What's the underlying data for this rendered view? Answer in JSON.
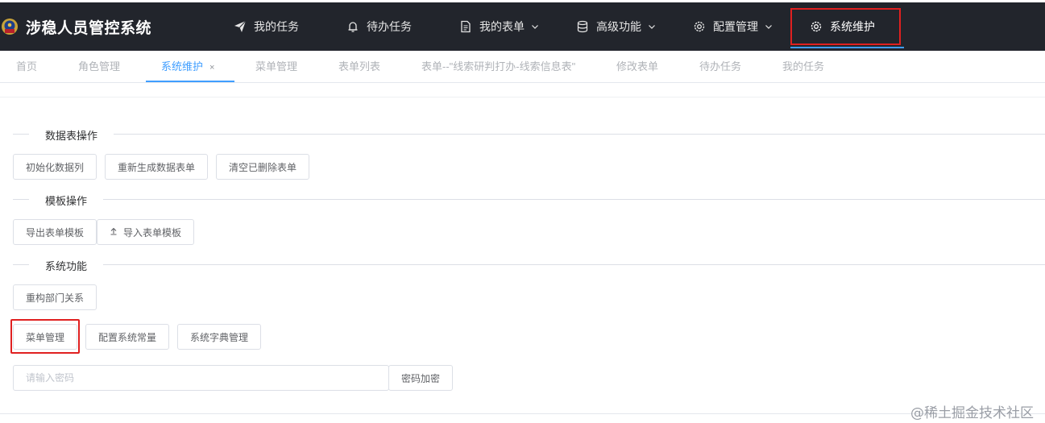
{
  "app": {
    "title": "涉稳人员管控系统",
    "accent_color": "#409eff",
    "header_bg": "#22252c",
    "highlight_color": "#e02020"
  },
  "nav": [
    {
      "label": "我的任务",
      "icon": "send-icon",
      "has_dropdown": false
    },
    {
      "label": "待办任务",
      "icon": "bell-icon",
      "has_dropdown": false
    },
    {
      "label": "我的表单",
      "icon": "document-icon",
      "has_dropdown": true
    },
    {
      "label": "高级功能",
      "icon": "database-icon",
      "has_dropdown": true
    },
    {
      "label": "配置管理",
      "icon": "gear-icon",
      "has_dropdown": true
    },
    {
      "label": "系统维护",
      "icon": "gear-icon",
      "has_dropdown": false,
      "active": true
    }
  ],
  "tabs": [
    {
      "label": "首页"
    },
    {
      "label": "角色管理"
    },
    {
      "label": "系统维护",
      "active": true,
      "close": "×"
    },
    {
      "label": "菜单管理"
    },
    {
      "label": "表单列表"
    },
    {
      "label": "表单--\"线索研判打办-线索信息表\""
    },
    {
      "label": "修改表单"
    },
    {
      "label": "待办任务"
    },
    {
      "label": "我的任务"
    }
  ],
  "sections": {
    "data_table": {
      "title": "数据表操作",
      "buttons": [
        "初始化数据列",
        "重新生成数据表单",
        "清空已删除表单"
      ]
    },
    "template": {
      "title": "模板操作",
      "buttons": [
        "导出表单模板",
        "导入表单模板"
      ]
    },
    "system": {
      "title": "系统功能",
      "buttons_row1": [
        "重构部门关系"
      ],
      "buttons_row2": [
        "菜单管理",
        "配置系统常量",
        "系统字典管理"
      ]
    }
  },
  "password": {
    "placeholder": "请输入密码",
    "button": "密码加密"
  },
  "watermark": "@稀土掘金技术社区"
}
